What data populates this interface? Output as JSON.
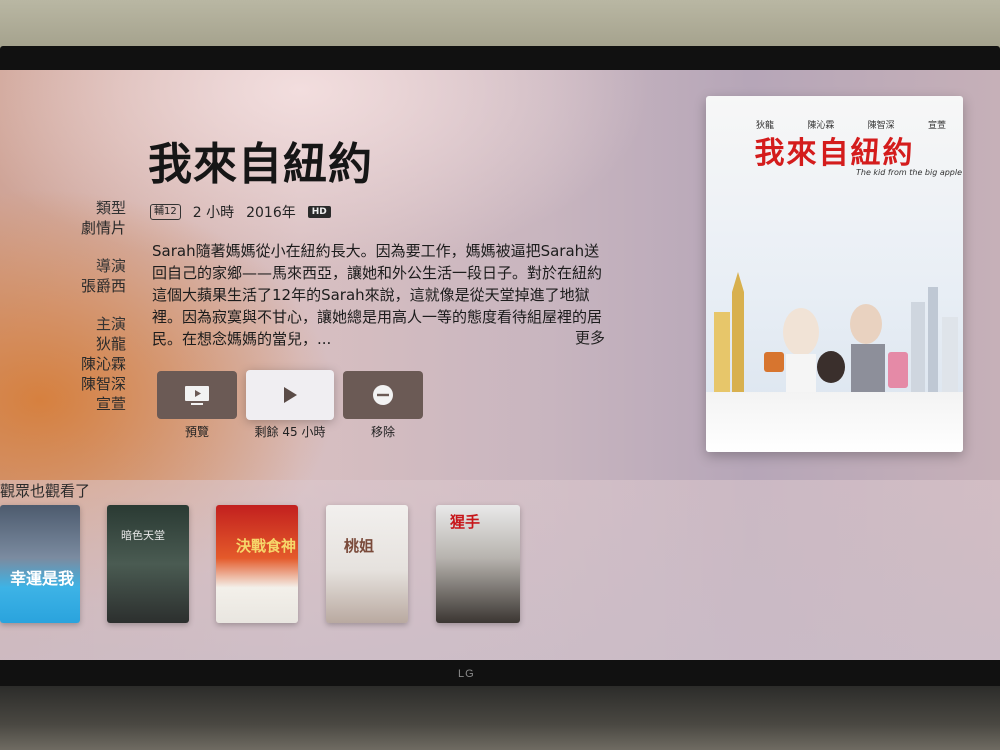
{
  "movie": {
    "title": "我來自紐約",
    "rating": "輔12",
    "duration": "2 小時",
    "year": "2016年",
    "quality": "HD",
    "description": "Sarah隨著媽媽從小在紐約長大。因為要工作，媽媽被逼把Sarah送回自己的家鄉——馬來西亞，讓她和外公生活一段日子。對於在紐約這個大蘋果生活了12年的Sarah來說，這就像是從天堂掉進了地獄裡。因為寂寞與不甘心，讓她總是用高人一等的態度看待組屋裡的居民。在想念媽媽的當兒，...",
    "more_label": "更多"
  },
  "credits": {
    "genre_label": "類型",
    "genre": "劇情片",
    "director_label": "導演",
    "director": "張爵西",
    "cast_label": "主演",
    "cast": [
      "狄龍",
      "陳沁霖",
      "陳智深",
      "宣萱"
    ]
  },
  "buttons": {
    "preview": "預覽",
    "play": "剩餘 45 小時",
    "remove": "移除"
  },
  "poster": {
    "cast": [
      "狄龍",
      "陳沁霖",
      "陳智深",
      "宣萱"
    ],
    "title": "我來自紐約",
    "subtitle": "The kid from the big apple"
  },
  "related": {
    "title": "觀眾也觀看了",
    "items": [
      "幸運是我",
      "暗色天堂",
      "決戰食神",
      "桃姐",
      "猩手"
    ]
  },
  "tv_brand": "LG",
  "colors": {
    "poster_title": "#d41c1c",
    "focus_button": "#f0eef2",
    "button": "#6b5a55"
  }
}
